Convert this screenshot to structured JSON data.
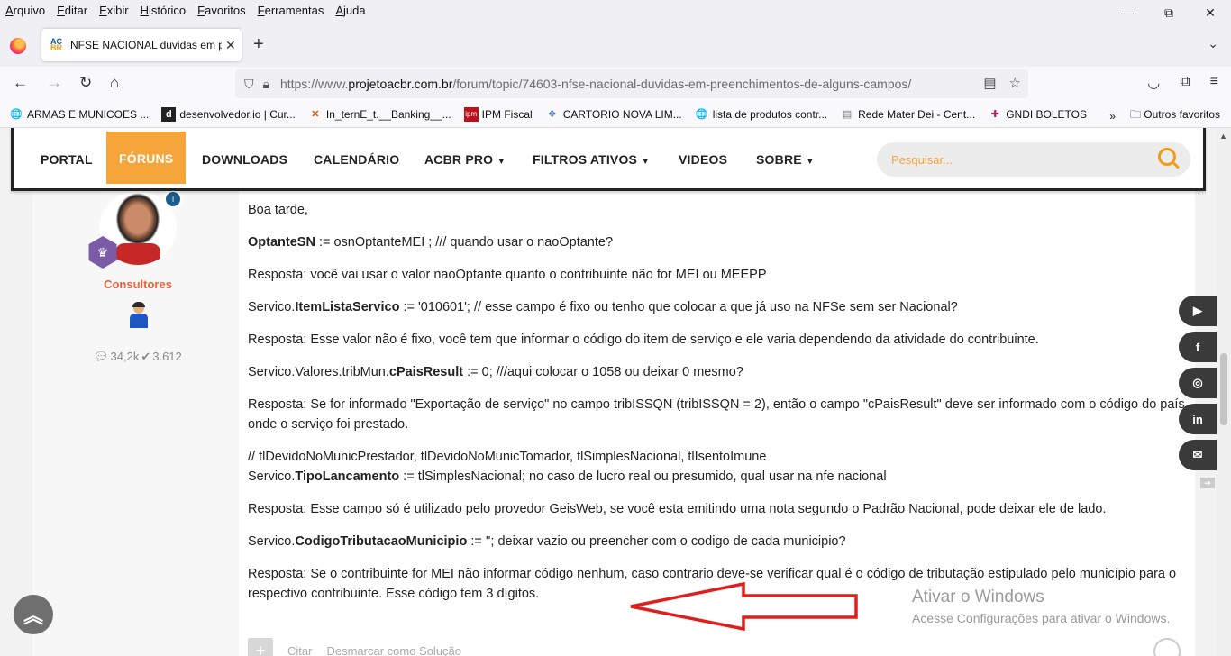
{
  "menu": [
    {
      "ul": "A",
      "rest": "rquivo"
    },
    {
      "ul": "E",
      "rest": "ditar"
    },
    {
      "ul": "E",
      "rest": "xibir"
    },
    {
      "ul": "H",
      "rest": "istórico"
    },
    {
      "ul": "F",
      "rest": "avoritos"
    },
    {
      "ul": "F",
      "rest": "erramentas"
    },
    {
      "ul": "A",
      "rest": "juda"
    }
  ],
  "window": {
    "min": "—",
    "max": "⧉",
    "close": "✕"
  },
  "tab": {
    "favicon_top": "AC",
    "favicon_bottom": "BR",
    "title": "NFSE NACIONAL duvidas em pr",
    "close": "✕",
    "new": "+",
    "list": "⌄"
  },
  "nav": {
    "url_prefix": "https://www.",
    "url_domain": "projetoacbr.com.br",
    "url_path": "/forum/topic/74603-nfse-nacional-duvidas-em-preenchimentos-de-alguns-campos/"
  },
  "bookmarks": [
    {
      "icon": "globe-icon",
      "glyph": "🌐",
      "label": "ARMAS E MUNICOES ..."
    },
    {
      "icon": "d-icon",
      "glyph": "d",
      "label": "desenvolvedor.io | Cur..."
    },
    {
      "icon": "x-icon",
      "glyph": "✕",
      "label": "In_ternE_t.__Banking__..."
    },
    {
      "icon": "ipm-icon",
      "glyph": "ipm",
      "label": "IPM Fiscal"
    },
    {
      "icon": "cartorio-icon",
      "glyph": "❖",
      "label": "CARTORIO NOVA LIM..."
    },
    {
      "icon": "globe-icon",
      "glyph": "🌐",
      "label": "lista de produtos contr..."
    },
    {
      "icon": "doc-icon",
      "glyph": "▤",
      "label": "Rede Mater Dei - Cent..."
    },
    {
      "icon": "cross-icon",
      "glyph": "✚",
      "label": "GNDI BOLETOS"
    }
  ],
  "bookmarks_more": "»",
  "other_bookmarks": "Outros favoritos",
  "site_nav": {
    "portal": "PORTAL",
    "foruns": "FÓRUNS",
    "downloads": "DOWNLOADS",
    "calendario": "CALENDÁRIO",
    "acbrpro": "ACBR PRO",
    "filtros": "FILTROS ATIVOS",
    "videos": "VIDEOS",
    "sobre": "SOBRE",
    "search_placeholder": "Pesquisar..."
  },
  "author": {
    "group": "Consultores",
    "comments": "34,2k",
    "solutions": "3.612"
  },
  "content": {
    "p1": "Boa tarde,",
    "p2_b": "OptanteSN",
    "p2": " := osnOptanteMEI ; /// quando usar o naoOptante?",
    "p3": "Resposta: você vai usar o valor naoOptante quanto o contribuinte não for MEI ou MEEPP",
    "p4_a": "Servico.",
    "p4_b": "ItemListaServico",
    "p4_c": " := '010601';   // esse campo é fixo ou tenho que colocar a que já uso na NFSe sem ser Nacional?",
    "p5": "Resposta: Esse valor não é fixo, você tem que informar o código do item de serviço e ele varia dependendo da atividade do contribuinte.",
    "p6_a": "Servico.Valores.tribMun.",
    "p6_b": "cPaisResult",
    "p6_c": " := 0;         ///aqui colocar o 1058 ou deixar 0 mesmo?",
    "p7": "Resposta: Se for informado \"Exportação de serviço\" no campo tribISSQN (tribISSQN = 2), então o campo \"cPaisResult\" deve ser informado com o código do país onde o serviço foi prestado.",
    "p8_l1": " // tlDevidoNoMunicPrestador, tlDevidoNoMunicTomador, tlSimplesNacional, tlIsentoImune",
    "p8_a": "Servico.",
    "p8_b": "TipoLancamento",
    "p8_c": " := tlSimplesNacional; no caso de lucro real ou presumido, qual usar na nfe nacional",
    "p9": "Resposta: Esse campo só é utilizado pelo provedor GeisWeb, se você esta emitindo uma nota segundo o Padrão Nacional, pode deixar ele de lado.",
    "p10_a": "Servico.",
    "p10_b": "CodigoTributacaoMunicipio",
    "p10_c": " := '';  deixar vazio ou preencher com o codigo de cada municipio?",
    "p11": "Resposta: Se o contribuinte for MEI não informar código nenhum, caso contrario deve-se verificar qual é o código de tributação estipulado pelo município para o respectivo contribuinte. Esse código tem 3 dígitos."
  },
  "post_actions": {
    "plus": "+",
    "quote": "Citar",
    "unmark": "Desmarcar como Solução"
  },
  "social": [
    "▶",
    "f",
    "◎",
    "in",
    "✉"
  ],
  "watermark": {
    "line1": "Ativar o Windows",
    "line2": "Acesse Configurações para ativar o Windows."
  },
  "colors": {
    "accent": "#f6a53a",
    "arrow": "#e01e1e",
    "group": "#e8643c"
  }
}
